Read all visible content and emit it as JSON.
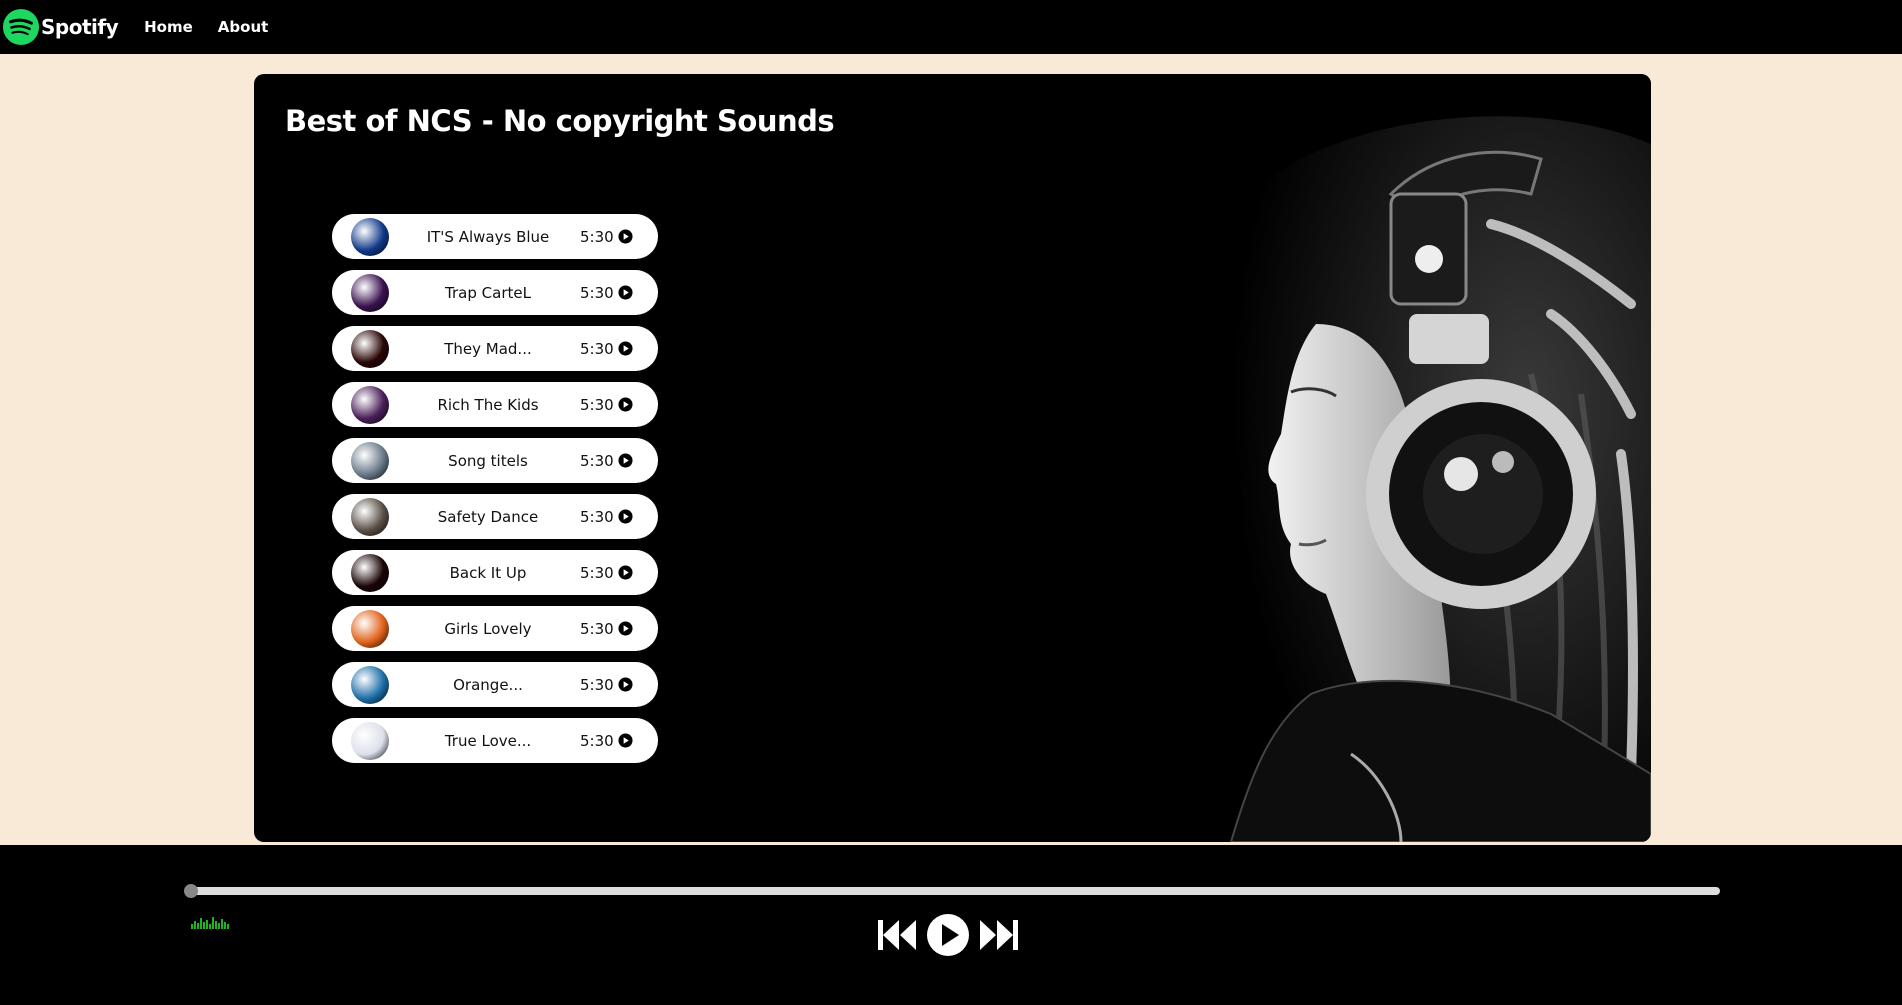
{
  "nav": {
    "brand": "Spotify",
    "links": [
      {
        "label": "Home"
      },
      {
        "label": "About"
      }
    ]
  },
  "colors": {
    "page_bg": "#f9ead7",
    "brand_green": "#1ed760",
    "panel": "#000000",
    "wave_green": "#1db521"
  },
  "player_panel": {
    "title": "Best of NCS - No copyright Sounds",
    "songs": [
      {
        "name": "IT'S Always Blue",
        "duration": "5:30",
        "cover_color": "#123a8a"
      },
      {
        "name": "Trap CarteL",
        "duration": "5:30",
        "cover_color": "#3a1250"
      },
      {
        "name": "They Mad...",
        "duration": "5:30",
        "cover_color": "#2a0606"
      },
      {
        "name": "Rich The Kids",
        "duration": "5:30",
        "cover_color": "#4a1f5a"
      },
      {
        "name": "Song titels",
        "duration": "5:30",
        "cover_color": "#6a7a8a"
      },
      {
        "name": "Safety Dance",
        "duration": "5:30",
        "cover_color": "#5a5048"
      },
      {
        "name": "Back It Up",
        "duration": "5:30",
        "cover_color": "#1a0505"
      },
      {
        "name": "Girls Lovely",
        "duration": "5:30",
        "cover_color": "#e0621a"
      },
      {
        "name": "Orange...",
        "duration": "5:30",
        "cover_color": "#1e6fa8"
      },
      {
        "name": "True Love...",
        "duration": "5:30",
        "cover_color": "#dde0ea"
      }
    ]
  },
  "bottom_bar": {
    "progress_fraction": 0.0,
    "controls": [
      "previous-icon",
      "play-icon",
      "next-icon"
    ]
  }
}
